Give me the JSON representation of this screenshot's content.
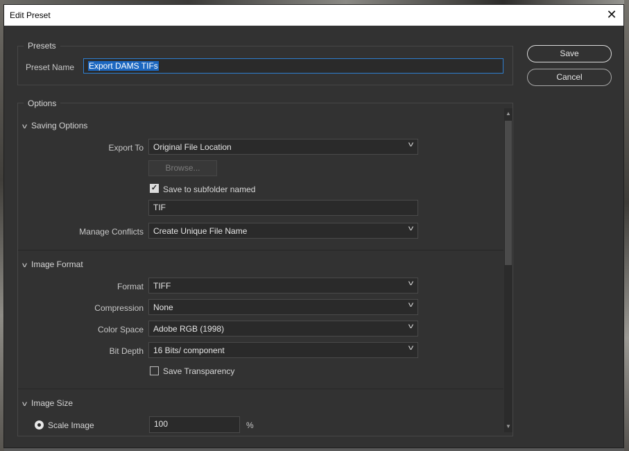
{
  "dialog": {
    "title": "Edit Preset",
    "close_glyph": "✕"
  },
  "presets": {
    "group_label": "Presets",
    "name_label": "Preset Name",
    "name_value": "Export DAMS TIFs"
  },
  "buttons": {
    "save": "Save",
    "cancel": "Cancel"
  },
  "options": {
    "group_label": "Options",
    "saving": {
      "heading": "Saving Options",
      "export_to_label": "Export To",
      "export_to_value": "Original File Location",
      "browse": "Browse...",
      "subfolder_checked": true,
      "subfolder_label": "Save to subfolder named",
      "subfolder_value": "TIF",
      "conflicts_label": "Manage Conflicts",
      "conflicts_value": "Create Unique File Name"
    },
    "image_format": {
      "heading": "Image Format",
      "format_label": "Format",
      "format_value": "TIFF",
      "compression_label": "Compression",
      "compression_value": "None",
      "color_space_label": "Color Space",
      "color_space_value": "Adobe RGB (1998)",
      "bit_depth_label": "Bit Depth",
      "bit_depth_value": "16 Bits/ component",
      "transparency_checked": false,
      "transparency_label": "Save Transparency"
    },
    "image_size": {
      "heading": "Image Size",
      "scale_label": "Scale Image",
      "scale_value": "100",
      "scale_unit": "%"
    }
  },
  "glyphs": {
    "chevron": "v",
    "caret": "v",
    "check": "✓",
    "up": "▲",
    "down": "▼"
  }
}
